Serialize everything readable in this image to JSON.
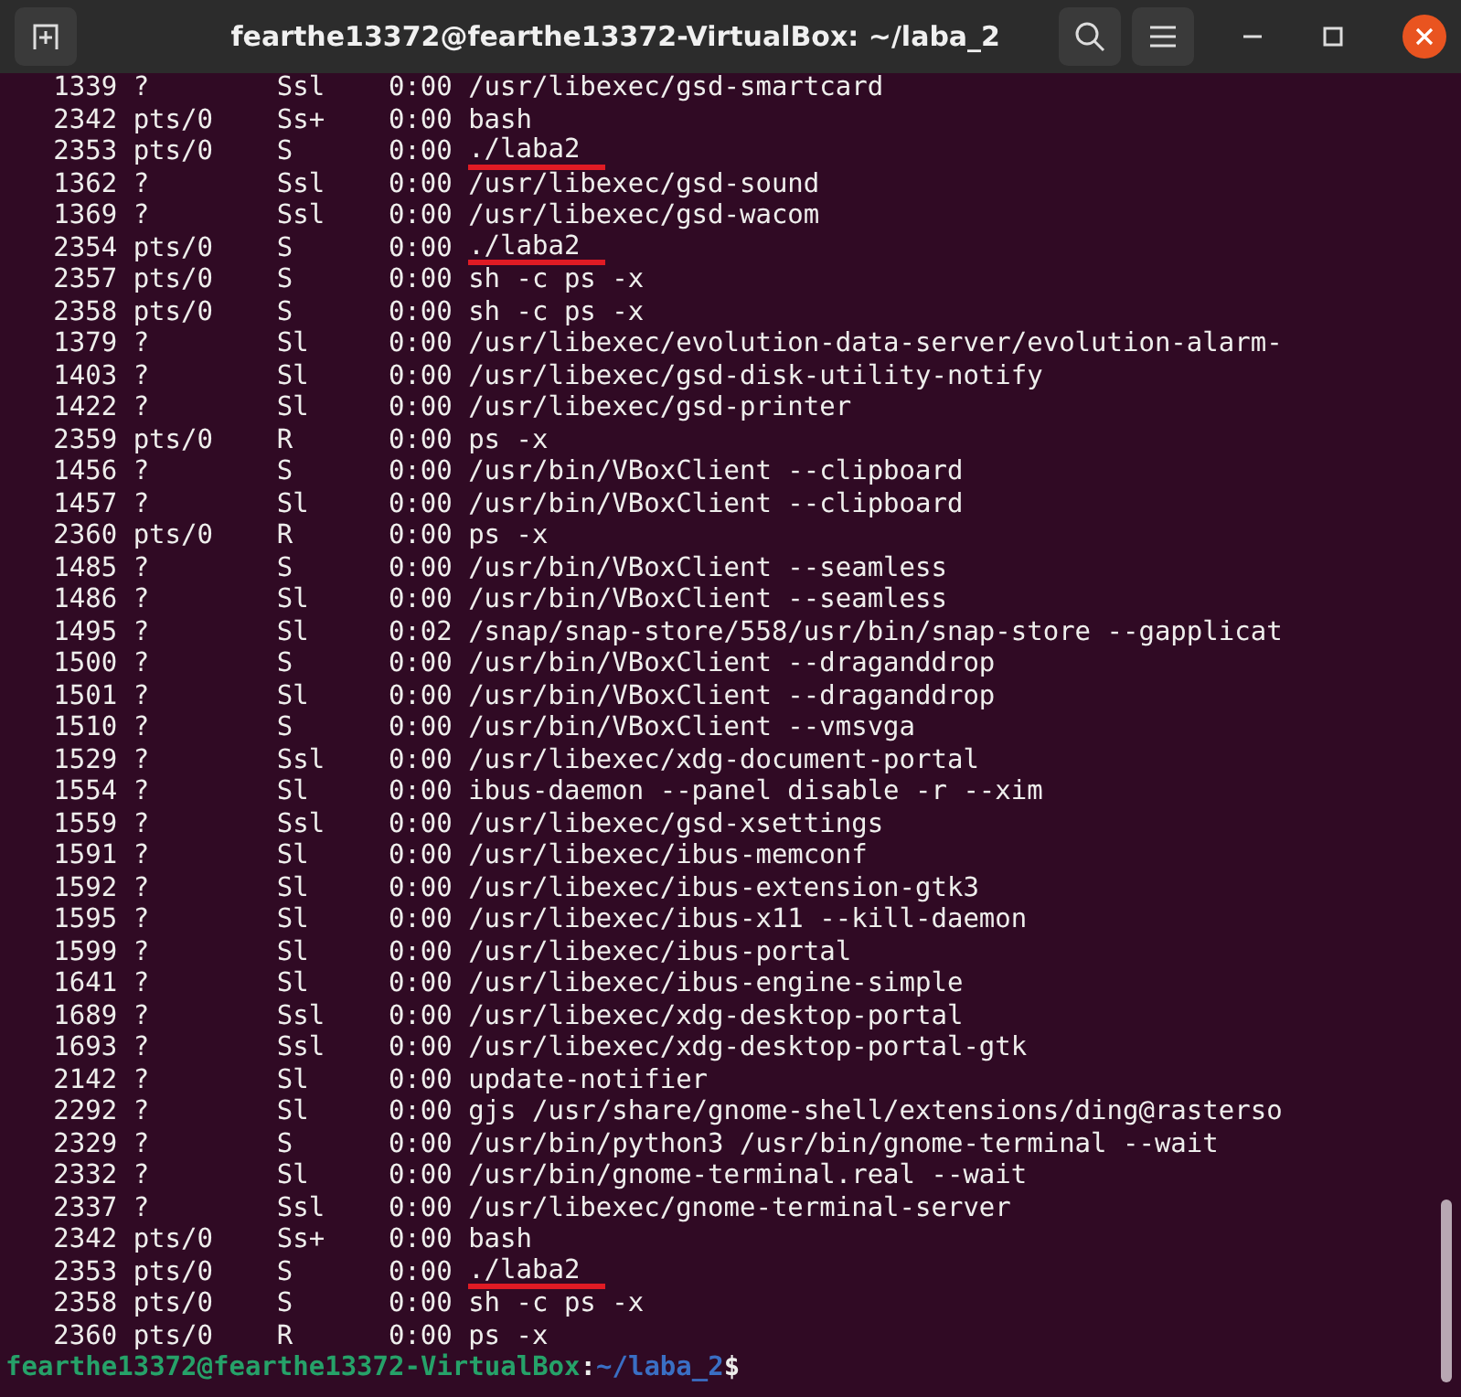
{
  "window": {
    "title": "fearthe13372@fearthe13372-VirtualBox: ~/laba_2"
  },
  "rows": [
    {
      "pid": "1339",
      "tty": "?",
      "stat": "Ssl",
      "time": "0:00",
      "command": "/usr/libexec/gsd-smartcard",
      "underlined": false
    },
    {
      "pid": "2342",
      "tty": "pts/0",
      "stat": "Ss+",
      "time": "0:00",
      "command": "bash",
      "underlined": false
    },
    {
      "pid": "2353",
      "tty": "pts/0",
      "stat": "S",
      "time": "0:00",
      "command": "./laba2",
      "underlined": true
    },
    {
      "pid": "1362",
      "tty": "?",
      "stat": "Ssl",
      "time": "0:00",
      "command": "/usr/libexec/gsd-sound",
      "underlined": false
    },
    {
      "pid": "1369",
      "tty": "?",
      "stat": "Ssl",
      "time": "0:00",
      "command": "/usr/libexec/gsd-wacom",
      "underlined": false
    },
    {
      "pid": "2354",
      "tty": "pts/0",
      "stat": "S",
      "time": "0:00",
      "command": "./laba2",
      "underlined": true
    },
    {
      "pid": "2357",
      "tty": "pts/0",
      "stat": "S",
      "time": "0:00",
      "command": "sh -c ps -x",
      "underlined": false
    },
    {
      "pid": "2358",
      "tty": "pts/0",
      "stat": "S",
      "time": "0:00",
      "command": "sh -c ps -x",
      "underlined": false
    },
    {
      "pid": "1379",
      "tty": "?",
      "stat": "Sl",
      "time": "0:00",
      "command": "/usr/libexec/evolution-data-server/evolution-alarm-",
      "underlined": false
    },
    {
      "pid": "1403",
      "tty": "?",
      "stat": "Sl",
      "time": "0:00",
      "command": "/usr/libexec/gsd-disk-utility-notify",
      "underlined": false
    },
    {
      "pid": "1422",
      "tty": "?",
      "stat": "Sl",
      "time": "0:00",
      "command": "/usr/libexec/gsd-printer",
      "underlined": false
    },
    {
      "pid": "2359",
      "tty": "pts/0",
      "stat": "R",
      "time": "0:00",
      "command": "ps -x",
      "underlined": false
    },
    {
      "pid": "1456",
      "tty": "?",
      "stat": "S",
      "time": "0:00",
      "command": "/usr/bin/VBoxClient --clipboard",
      "underlined": false
    },
    {
      "pid": "1457",
      "tty": "?",
      "stat": "Sl",
      "time": "0:00",
      "command": "/usr/bin/VBoxClient --clipboard",
      "underlined": false
    },
    {
      "pid": "2360",
      "tty": "pts/0",
      "stat": "R",
      "time": "0:00",
      "command": "ps -x",
      "underlined": false
    },
    {
      "pid": "1485",
      "tty": "?",
      "stat": "S",
      "time": "0:00",
      "command": "/usr/bin/VBoxClient --seamless",
      "underlined": false
    },
    {
      "pid": "1486",
      "tty": "?",
      "stat": "Sl",
      "time": "0:00",
      "command": "/usr/bin/VBoxClient --seamless",
      "underlined": false
    },
    {
      "pid": "1495",
      "tty": "?",
      "stat": "Sl",
      "time": "0:02",
      "command": "/snap/snap-store/558/usr/bin/snap-store --gapplicat",
      "underlined": false
    },
    {
      "pid": "1500",
      "tty": "?",
      "stat": "S",
      "time": "0:00",
      "command": "/usr/bin/VBoxClient --draganddrop",
      "underlined": false
    },
    {
      "pid": "1501",
      "tty": "?",
      "stat": "Sl",
      "time": "0:00",
      "command": "/usr/bin/VBoxClient --draganddrop",
      "underlined": false
    },
    {
      "pid": "1510",
      "tty": "?",
      "stat": "S",
      "time": "0:00",
      "command": "/usr/bin/VBoxClient --vmsvga",
      "underlined": false
    },
    {
      "pid": "1529",
      "tty": "?",
      "stat": "Ssl",
      "time": "0:00",
      "command": "/usr/libexec/xdg-document-portal",
      "underlined": false
    },
    {
      "pid": "1554",
      "tty": "?",
      "stat": "Sl",
      "time": "0:00",
      "command": "ibus-daemon --panel disable -r --xim",
      "underlined": false
    },
    {
      "pid": "1559",
      "tty": "?",
      "stat": "Ssl",
      "time": "0:00",
      "command": "/usr/libexec/gsd-xsettings",
      "underlined": false
    },
    {
      "pid": "1591",
      "tty": "?",
      "stat": "Sl",
      "time": "0:00",
      "command": "/usr/libexec/ibus-memconf",
      "underlined": false
    },
    {
      "pid": "1592",
      "tty": "?",
      "stat": "Sl",
      "time": "0:00",
      "command": "/usr/libexec/ibus-extension-gtk3",
      "underlined": false
    },
    {
      "pid": "1595",
      "tty": "?",
      "stat": "Sl",
      "time": "0:00",
      "command": "/usr/libexec/ibus-x11 --kill-daemon",
      "underlined": false
    },
    {
      "pid": "1599",
      "tty": "?",
      "stat": "Sl",
      "time": "0:00",
      "command": "/usr/libexec/ibus-portal",
      "underlined": false
    },
    {
      "pid": "1641",
      "tty": "?",
      "stat": "Sl",
      "time": "0:00",
      "command": "/usr/libexec/ibus-engine-simple",
      "underlined": false
    },
    {
      "pid": "1689",
      "tty": "?",
      "stat": "Ssl",
      "time": "0:00",
      "command": "/usr/libexec/xdg-desktop-portal",
      "underlined": false
    },
    {
      "pid": "1693",
      "tty": "?",
      "stat": "Ssl",
      "time": "0:00",
      "command": "/usr/libexec/xdg-desktop-portal-gtk",
      "underlined": false
    },
    {
      "pid": "2142",
      "tty": "?",
      "stat": "Sl",
      "time": "0:00",
      "command": "update-notifier",
      "underlined": false
    },
    {
      "pid": "2292",
      "tty": "?",
      "stat": "Sl",
      "time": "0:00",
      "command": "gjs /usr/share/gnome-shell/extensions/ding@rasterso",
      "underlined": false
    },
    {
      "pid": "2329",
      "tty": "?",
      "stat": "S",
      "time": "0:00",
      "command": "/usr/bin/python3 /usr/bin/gnome-terminal --wait",
      "underlined": false
    },
    {
      "pid": "2332",
      "tty": "?",
      "stat": "Sl",
      "time": "0:00",
      "command": "/usr/bin/gnome-terminal.real --wait",
      "underlined": false
    },
    {
      "pid": "2337",
      "tty": "?",
      "stat": "Ssl",
      "time": "0:00",
      "command": "/usr/libexec/gnome-terminal-server",
      "underlined": false
    },
    {
      "pid": "2342",
      "tty": "pts/0",
      "stat": "Ss+",
      "time": "0:00",
      "command": "bash",
      "underlined": false
    },
    {
      "pid": "2353",
      "tty": "pts/0",
      "stat": "S",
      "time": "0:00",
      "command": "./laba2",
      "underlined": true
    },
    {
      "pid": "2358",
      "tty": "pts/0",
      "stat": "S",
      "time": "0:00",
      "command": "sh -c ps -x",
      "underlined": false
    },
    {
      "pid": "2360",
      "tty": "pts/0",
      "stat": "R",
      "time": "0:00",
      "command": "ps -x",
      "underlined": false
    }
  ],
  "prompt": {
    "user_host": "fearthe13372@fearthe13372-VirtualBox",
    "separator": ":",
    "path": "~/laba_2",
    "symbol": "$"
  }
}
